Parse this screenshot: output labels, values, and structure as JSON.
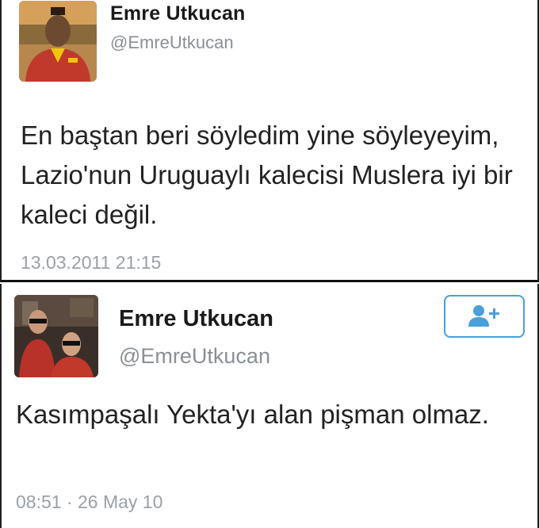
{
  "tweets": [
    {
      "author_name": "Emre Utkucan",
      "author_handle": "@EmreUtkucan",
      "text": "En baştan beri söyledim yine söyleyeyim, Lazio'nun Uruguaylı kalecisi Muslera iyi bir kaleci değil.",
      "timestamp": "13.03.2011 21:15"
    },
    {
      "author_name": "Emre Utkucan",
      "author_handle": "@EmreUtkucan",
      "text": "Kasımpaşalı Yekta'yı alan pişman olmaz.",
      "timestamp": "08:51 · 26 May 10",
      "follow_icon": "add-user-icon"
    }
  ],
  "colors": {
    "name": "#1a1a1a",
    "handle": "#8a8f94",
    "timestamp": "#9aa0a6",
    "follow_accent": "#4aa0d8"
  }
}
